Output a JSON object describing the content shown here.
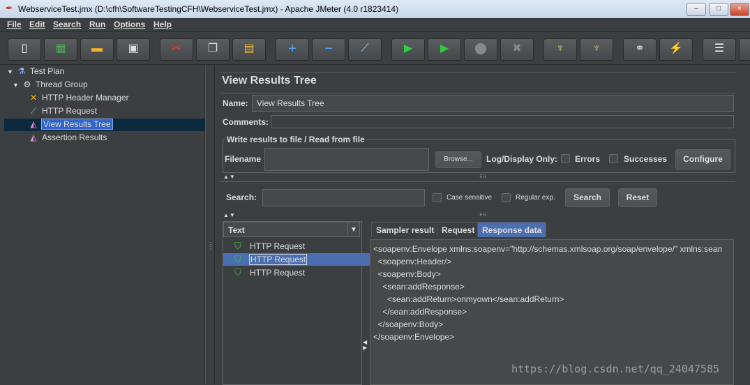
{
  "window": {
    "title": "WebserviceTest.jmx (D:\\cfh\\SoftwareTestingCFH\\WebserviceTest.jmx) - Apache JMeter (4.0 r1823414)",
    "controls": [
      "–",
      "□",
      "×"
    ]
  },
  "menu": [
    "File",
    "Edit",
    "Search",
    "Run",
    "Options",
    "Help"
  ],
  "tree": {
    "items": [
      {
        "label": "Test Plan",
        "icon": "flask-icon"
      },
      {
        "label": "Thread Group",
        "icon": "gear-icon"
      },
      {
        "label": "HTTP Header Manager",
        "icon": "wrench-icon"
      },
      {
        "label": "HTTP Request",
        "icon": "pipette-icon"
      },
      {
        "label": "View Results Tree",
        "icon": "chart-icon"
      },
      {
        "label": "Assertion Results",
        "icon": "chart-icon"
      }
    ]
  },
  "panel": {
    "title": "View Results Tree",
    "name_label": "Name:",
    "name_value": "View Results Tree",
    "comments_label": "Comments:",
    "file_section": "Write results to file / Read from file",
    "filename_label": "Filename",
    "browse": "Browse...",
    "log_display": "Log/Display Only:",
    "errors": "Errors",
    "successes": "Successes",
    "configure": "Configure",
    "search_label": "Search:",
    "case_sensitive": "Case sensitive",
    "regular_exp": "Regular exp.",
    "search_button": "Search",
    "reset_button": "Reset",
    "renderer": "Text",
    "results": [
      "HTTP Request",
      "HTTP Request",
      "HTTP Request"
    ],
    "tabs": [
      "Sampler result",
      "Request",
      "Response data"
    ],
    "response_lines": [
      "<soapenv:Envelope xmlns:soapenv=\"http://schemas.xmlsoap.org/soap/envelope/\" xmlns:sean",
      "  <soapenv:Header/>",
      "  <soapenv:Body>",
      "    <sean:addResponse>",
      "      <sean:addReturn>onmyown</sean:addReturn>",
      "    </sean:addResponse>",
      "  </soapenv:Body>",
      "</soapenv:Envelope>"
    ]
  },
  "watermark": "https://blog.csdn.net/qq_24047585"
}
